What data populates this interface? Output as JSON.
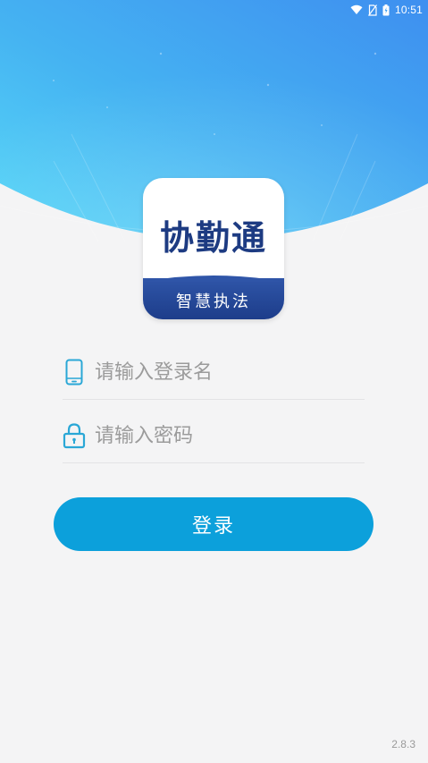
{
  "status_bar": {
    "time": "10:51",
    "icons": [
      "wifi-icon",
      "no-sim-icon",
      "battery-charging-icon"
    ]
  },
  "logo": {
    "title": "协勤通",
    "subtitle": "智慧执法"
  },
  "login_form": {
    "username": {
      "placeholder": "请输入登录名",
      "value": "",
      "icon": "phone-icon"
    },
    "password": {
      "placeholder": "请输入密码",
      "value": "",
      "icon": "lock-icon"
    },
    "submit_label": "登录"
  },
  "footer": {
    "version": "2.8.3"
  },
  "colors": {
    "header_blue": "#3f9af0",
    "header_cyan": "#4fd4f6",
    "button": "#0ca0db",
    "icon_accent": "#2aa7d6",
    "logo_text": "#1d3b82",
    "logo_band": "#2447954"
  }
}
